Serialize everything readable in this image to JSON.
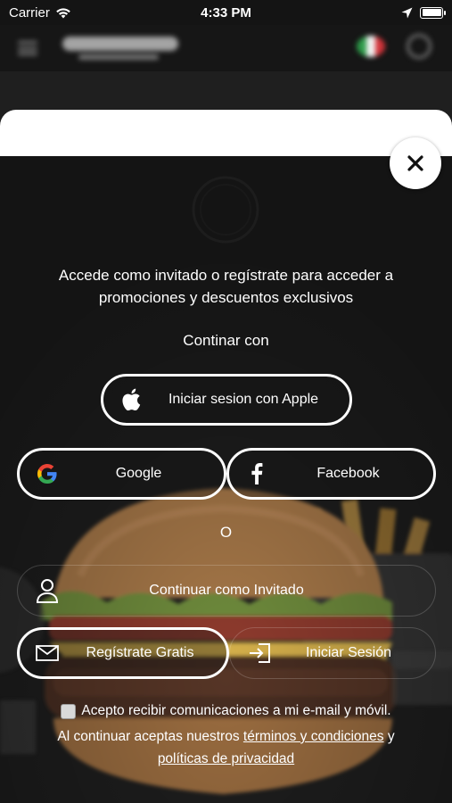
{
  "status_bar": {
    "carrier": "Carrier",
    "time": "4:33 PM"
  },
  "modal": {
    "intro_text": "Accede como invitado o regístrate para acceder a promociones y descuentos exclusivos",
    "continue_with": "Continar con",
    "apple_label": "Iniciar sesion con Apple",
    "google_label": "Google",
    "facebook_label": "Facebook",
    "or_text": "O",
    "guest_label": "Continuar como Invitado",
    "register_label": "Regístrate Gratis",
    "login_label": "Iniciar Sesión",
    "consent_label": "Acepto recibir comunicaciones a mi e-mail y móvil.",
    "terms_prefix": "Al continuar aceptas nuestros",
    "terms_link": "términos y condiciones",
    "terms_and": "y",
    "privacy_link": "políticas de privacidad",
    "consent_checked": false
  },
  "colors": {
    "background": "#1e1e1e",
    "text": "#ffffff",
    "flag_green": "#2e9c4a",
    "flag_white": "#f2f2f2",
    "flag_red": "#d2343a",
    "google_blue": "#4285F4",
    "google_red": "#EA4335",
    "google_yellow": "#FBBC05",
    "google_green": "#34A853"
  },
  "icons": {
    "apple": "apple-icon",
    "google": "google-icon",
    "facebook": "facebook-icon",
    "guest": "person-icon",
    "register": "envelope-icon",
    "login": "sign-in-icon",
    "close": "close-icon"
  }
}
